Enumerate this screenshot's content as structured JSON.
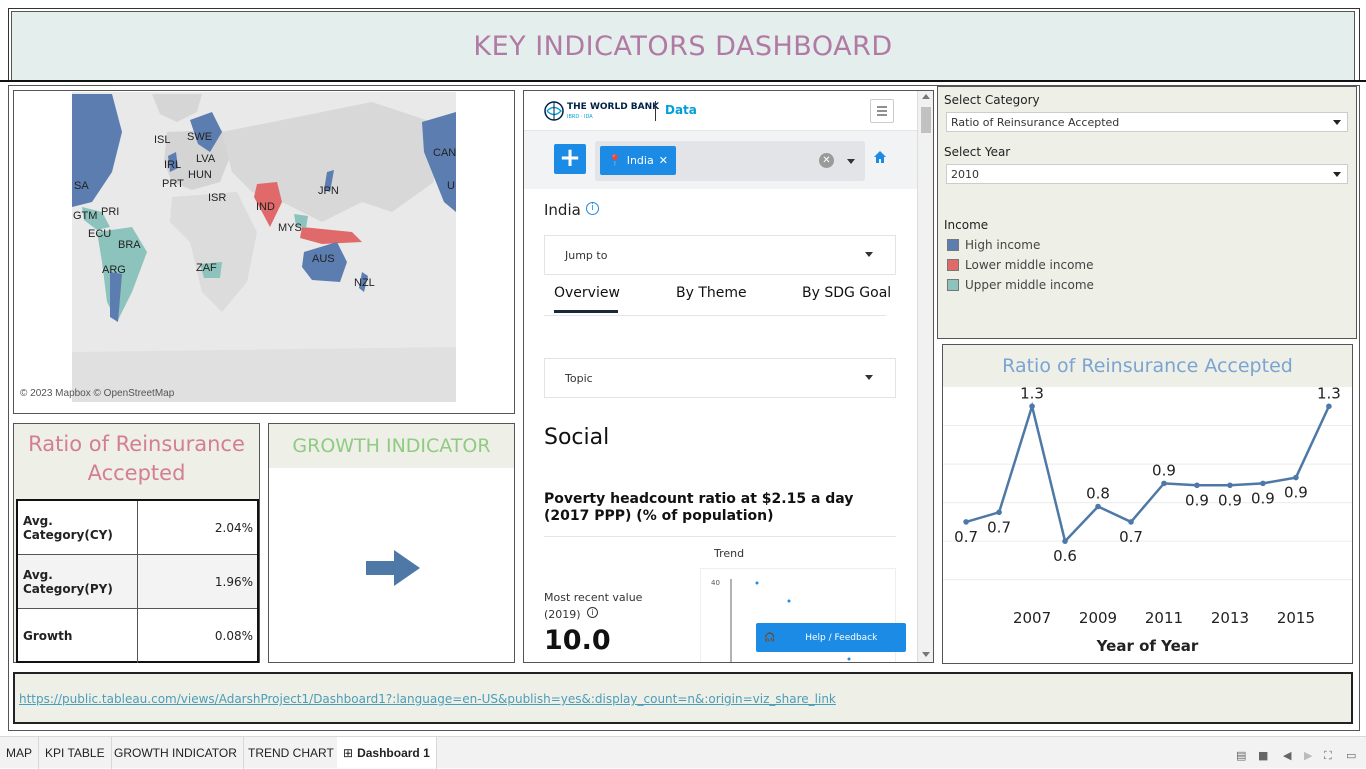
{
  "header": {
    "title": "KEY INDICATORS DASHBOARD"
  },
  "map": {
    "credit": "© 2023 Mapbox © OpenStreetMap",
    "labels": [
      "ISL",
      "SWE",
      "IRL",
      "LVA",
      "HUN",
      "PRT",
      "ISR",
      "IND",
      "JPN",
      "CAN",
      "SA",
      "U",
      "GTM",
      "PRI",
      "ECU",
      "BRA",
      "MYS",
      "ARG",
      "ZAF",
      "AUS",
      "NZL"
    ]
  },
  "kpi": {
    "title": "Ratio of Reinsurance Accepted",
    "rows": [
      {
        "label": "Avg. Category(CY)",
        "value": "2.04%"
      },
      {
        "label": "Avg. Category(PY)",
        "value": "1.96%"
      },
      {
        "label": "Growth",
        "value": "0.08%"
      }
    ]
  },
  "growth": {
    "title": "GROWTH INDICATOR"
  },
  "web": {
    "brand": "THE WORLD BANK",
    "brand_sub": "IBRD · IDA",
    "data_label": "Data",
    "chip": "India",
    "country": "India",
    "jump_to": "Jump to",
    "tabs": [
      "Overview",
      "By Theme",
      "By SDG Goal"
    ],
    "topic": "Topic",
    "section": "Social",
    "indicator": "Poverty headcount ratio at $2.15 a day (2017 PPP) (% of population)",
    "trend_label": "Trend",
    "recent_label": "Most recent value",
    "recent_year": "(2019)",
    "recent_value": "10.0",
    "spark_tick": "40",
    "spark_tick_low": "0",
    "help": "Help / Feedback"
  },
  "filters": {
    "category_label": "Select Category",
    "category_value": "Ratio of Reinsurance Accepted",
    "year_label": "Select Year",
    "year_value": "2010",
    "legend_title": "Income",
    "legend": [
      {
        "name": "High income",
        "color": "#5b7db0"
      },
      {
        "name": "Lower middle income",
        "color": "#e06a6a"
      },
      {
        "name": "Upper middle income",
        "color": "#8cc3bc"
      }
    ]
  },
  "chart_data": {
    "type": "line",
    "title": "Ratio of Reinsurance Accepted",
    "xlabel": "Year of Year",
    "ylabel": "",
    "x": [
      2005,
      2006,
      2007,
      2008,
      2009,
      2010,
      2011,
      2012,
      2013,
      2014,
      2015,
      2016
    ],
    "values": [
      0.7,
      0.75,
      1.3,
      0.6,
      0.78,
      0.7,
      0.9,
      0.89,
      0.89,
      0.9,
      0.93,
      1.3
    ],
    "point_labels": [
      "0.7",
      "0.7",
      "1.3",
      "0.6",
      "0.8",
      "0.7",
      "0.9",
      "0.9",
      "0.9",
      "0.9",
      "0.9",
      "1.3"
    ],
    "x_ticks": [
      "2007",
      "2009",
      "2011",
      "2013",
      "2015"
    ],
    "x_tick_values": [
      2007,
      2009,
      2011,
      2013,
      2015
    ],
    "xlim": [
      2004.3,
      2016.7
    ],
    "ylim": [
      0.3,
      1.4
    ],
    "color": "#4e79a7",
    "grid": true
  },
  "url": {
    "text": "https://public.tableau.com/views/AdarshProject1/Dashboard1?:language=en-US&publish=yes&:display_count=n&:origin=viz_share_link"
  },
  "tabs": {
    "items": [
      "MAP",
      "KPI TABLE",
      "GROWTH INDICATOR",
      "TREND CHART",
      "Dashboard 1"
    ],
    "active": "Dashboard 1"
  }
}
